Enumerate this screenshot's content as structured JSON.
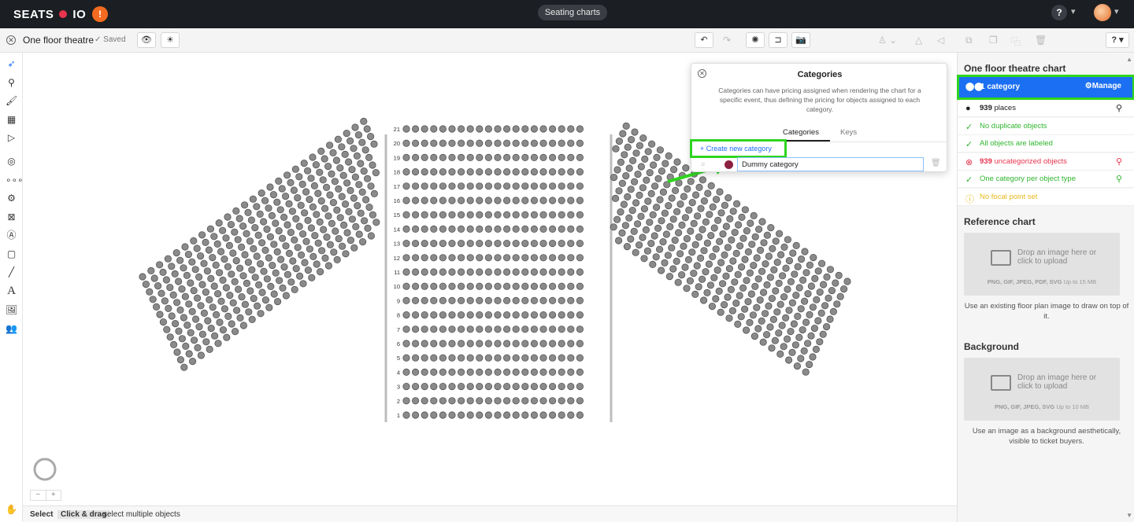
{
  "app": {
    "logo_left": "SEATS",
    "logo_right": "IO",
    "center_pill": "Seating charts",
    "help": "?",
    "chevron": "⌄"
  },
  "toolbar": {
    "chart_name": "One floor theatre",
    "saved_label": "Saved",
    "help": "?"
  },
  "dialog": {
    "title": "Categories",
    "description": "Categories can have pricing assigned when rendering the chart for a specific event, thus defining the pricing for objects assigned to each category.",
    "tab_categories": "Categories",
    "tab_keys": "Keys",
    "create_label": "Create new category",
    "category_value": "Dummy category",
    "category_color": "#8b2040"
  },
  "rightpanel": {
    "title": "One floor theatre chart",
    "categories_label": "1 category",
    "manage_label": "Manage",
    "places_count": "939",
    "places_label": "places",
    "checks": [
      {
        "text": "No duplicate objects",
        "status": "ok"
      },
      {
        "text": "All objects are labeled",
        "status": "ok"
      },
      {
        "count": "939",
        "text": "uncategorized objects",
        "status": "error"
      },
      {
        "text": "One category per object type",
        "status": "ok"
      },
      {
        "text": "No focal point set",
        "status": "warning"
      }
    ],
    "reference_title": "Reference chart",
    "reference_drop": "Drop an image here or click to upload",
    "reference_formats": "PNG, GIF, JPEG, PDF, SVG",
    "reference_limit": "Up to 15 MB",
    "reference_caption": "Use an existing floor plan image to draw on top of it.",
    "background_title": "Background",
    "background_drop": "Drop an image here or click to upload",
    "background_formats": "PNG, GIF, JPEG, SVG",
    "background_limit": "Up to 10 MB",
    "background_caption": "Use an image as a background aesthetically, visible to ticket buyers."
  },
  "statusbar": {
    "key1": "Select",
    "key2": "Click & drag",
    "desc2": "select multiple objects"
  },
  "canvas": {
    "row_labels": [
      "21",
      "20",
      "19",
      "18",
      "17",
      "16",
      "15",
      "14",
      "13",
      "12",
      "11",
      "10",
      "9",
      "8",
      "7",
      "6",
      "5",
      "4",
      "3",
      "2",
      "1"
    ],
    "zoom_minus": "−",
    "zoom_plus": "+"
  },
  "colors": {
    "accent_blue": "#1b6ff2",
    "highlight_green": "#2fd51f",
    "ok_green": "#2fb52f",
    "error_red": "#e8344e",
    "warning_yellow": "#e8b71a",
    "seat_fill": "#8a8a8a"
  }
}
